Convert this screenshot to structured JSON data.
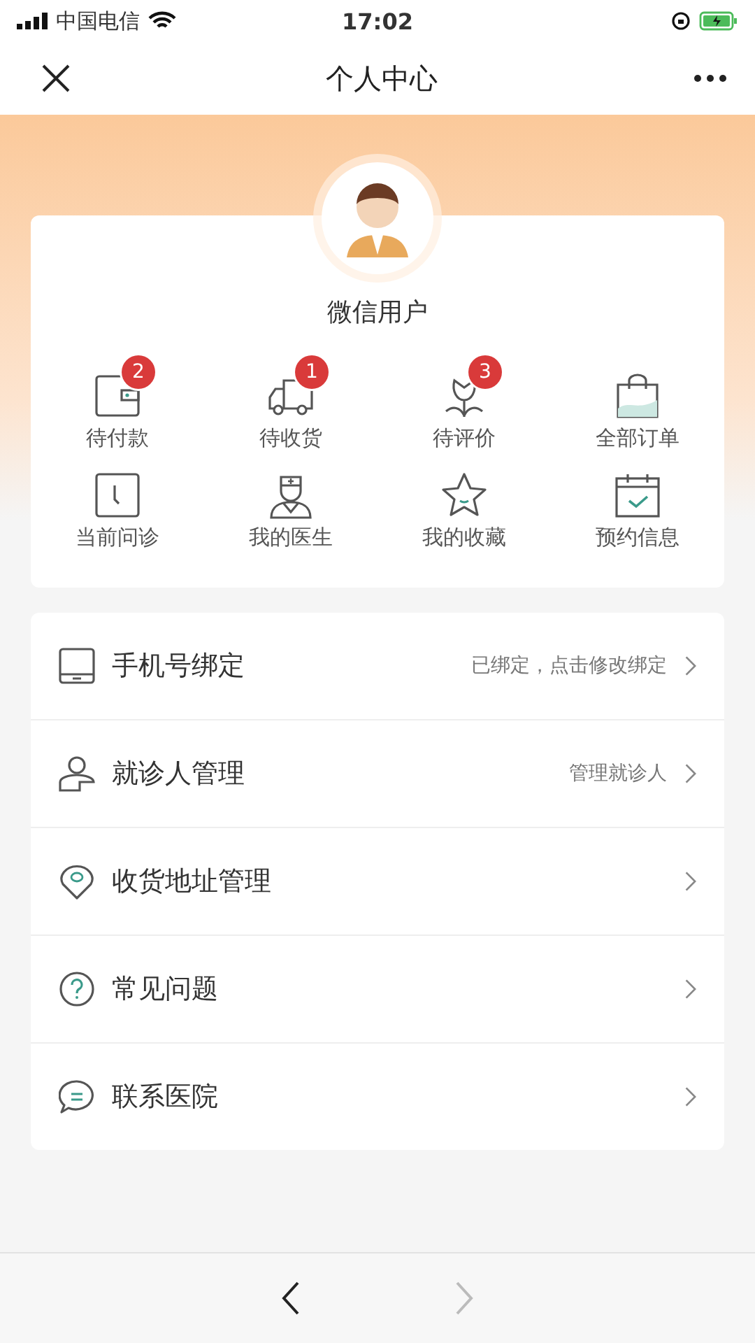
{
  "status_bar": {
    "carrier": "中国电信",
    "time": "17:02"
  },
  "nav_bar": {
    "title": "个人中心"
  },
  "profile": {
    "name": "微信用户"
  },
  "shortcuts": [
    {
      "kind": "wallet",
      "label": "待付款",
      "badge": "2"
    },
    {
      "kind": "truck",
      "label": "待收货",
      "badge": "1"
    },
    {
      "kind": "flower",
      "label": "待评价",
      "badge": "3"
    },
    {
      "kind": "bag",
      "label": "全部订单"
    },
    {
      "kind": "clock",
      "label": "当前问诊"
    },
    {
      "kind": "doctor",
      "label": "我的医生"
    },
    {
      "kind": "star",
      "label": "我的收藏"
    },
    {
      "kind": "calendar",
      "label": "预约信息"
    }
  ],
  "menu": [
    {
      "kind": "phone",
      "label": "手机号绑定",
      "detail": "已绑定，点击修改绑定"
    },
    {
      "kind": "person",
      "label": "就诊人管理",
      "detail": "管理就诊人"
    },
    {
      "kind": "pin",
      "label": "收货地址管理"
    },
    {
      "kind": "question",
      "label": "常见问题"
    },
    {
      "kind": "chat",
      "label": "联系医院"
    }
  ],
  "bottom_bar": {
    "back": {
      "disabled": false
    },
    "forward": {
      "disabled": true
    }
  }
}
